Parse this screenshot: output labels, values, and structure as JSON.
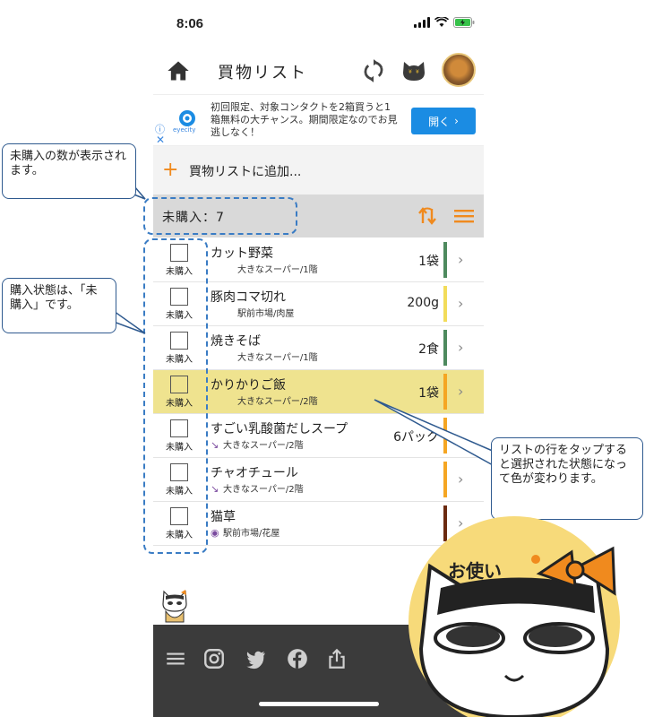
{
  "status": {
    "time": "8:06"
  },
  "header": {
    "title": "買物リスト"
  },
  "ad": {
    "info": "ⓘ",
    "close": "✕",
    "brand": "eyecity",
    "text": "初回限定、対象コンタクトを2箱買うと1箱無料の大チャンス。期間限定なのでお見逃しなく！",
    "button": "開く"
  },
  "add": {
    "label": "買物リストに追加..."
  },
  "count": {
    "label": "未購入：7"
  },
  "items": [
    {
      "name": "カット野菜",
      "sub": "大きなスーパー/1階",
      "qty": "1袋",
      "status": "未購入",
      "color": "#4e8a5e",
      "icon": "",
      "selected": false,
      "chevron": true
    },
    {
      "name": "豚肉コマ切れ",
      "sub": "駅前市場/肉屋",
      "qty": "200g",
      "status": "未購入",
      "color": "#f2dc5a",
      "icon": "",
      "selected": false,
      "chevron": true
    },
    {
      "name": "焼きそば",
      "sub": "大きなスーパー/1階",
      "qty": "2食",
      "status": "未購入",
      "color": "#4e8a5e",
      "icon": "",
      "selected": false,
      "chevron": true
    },
    {
      "name": "かりかりご飯",
      "sub": "大きなスーパー/2階",
      "qty": "1袋",
      "status": "未購入",
      "color": "#f5a623",
      "icon": "",
      "selected": true,
      "chevron": true
    },
    {
      "name": "すごい乳酸菌だしスープ",
      "sub": "大きなスーパー/2階",
      "qty": "6パック",
      "status": "未購入",
      "color": "#f5a623",
      "icon": "↘",
      "selected": false,
      "chevron": false
    },
    {
      "name": "チャオチュール",
      "sub": "大きなスーパー/2階",
      "qty": "",
      "status": "未購入",
      "color": "#f5a623",
      "icon": "↘",
      "selected": false,
      "chevron": true
    },
    {
      "name": "猫草",
      "sub": "駅前市場/花屋",
      "qty": "",
      "status": "未購入",
      "color": "#6b2a10",
      "icon": "◉",
      "selected": false,
      "chevron": true
    }
  ],
  "annotations": {
    "count_note": "未購入の数が表示されます。",
    "status_note": "購入状態は、「未購入」です。",
    "row_note": "リストの行をタップすると選択された状態になって色が変わります。",
    "badge": "お使い"
  },
  "colors": {
    "accent": "#f08a1e",
    "selected_row": "#efe38f",
    "bottom_bar": "#3b3b3b",
    "ad_button": "#1b8ce3"
  }
}
